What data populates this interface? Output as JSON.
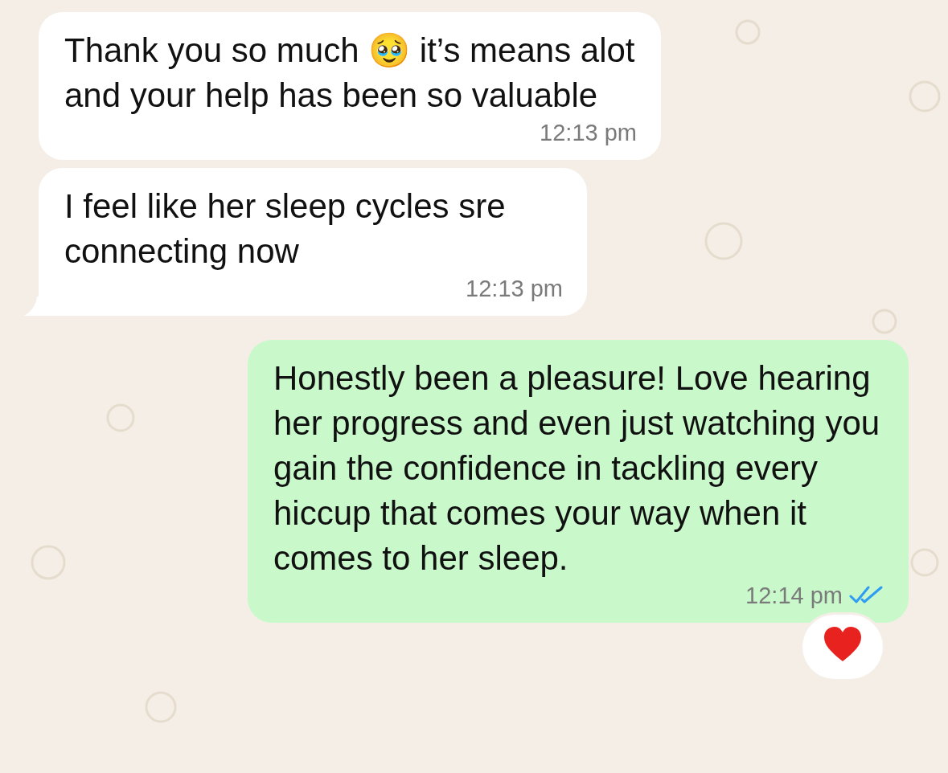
{
  "messages": [
    {
      "kind": "incoming",
      "text": "Thank you so much 🥹 it’s means alot and your help has been so valuable",
      "time": "12:13 pm",
      "tail": false
    },
    {
      "kind": "incoming",
      "text": "I feel like her sleep cycles sre connecting now",
      "time": "12:13 pm",
      "tail": true
    },
    {
      "kind": "outgoing",
      "text": "Honestly been a pleasure! Love hearing her progress and even just watching you gain the confidence in tackling every hiccup that comes your way when it comes to her sleep.",
      "time": "12:14 pm",
      "tail": false,
      "read": true,
      "reaction": {
        "kind": "heart"
      }
    }
  ]
}
